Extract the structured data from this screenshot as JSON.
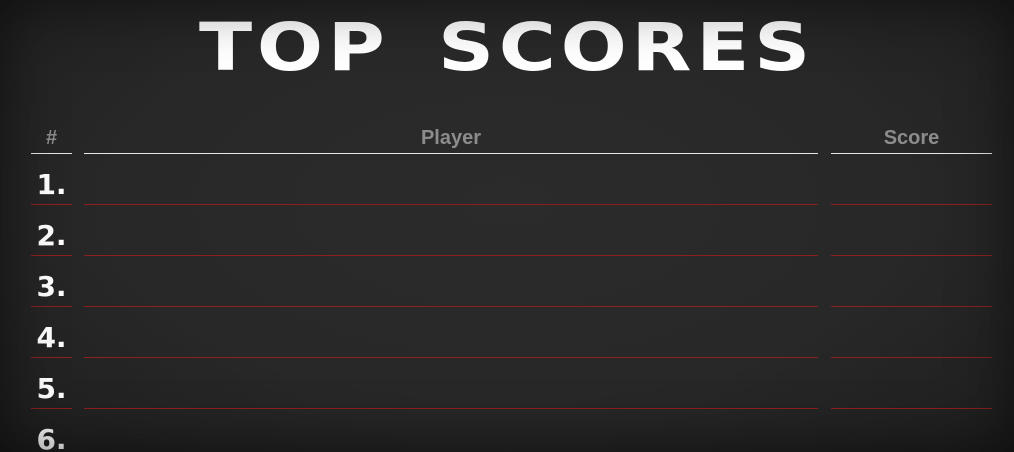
{
  "title": "TOP SCORES",
  "columns": {
    "rank": "#",
    "player": "Player",
    "score": "Score"
  },
  "rows": [
    {
      "rank": "1.",
      "player": "",
      "score": ""
    },
    {
      "rank": "2.",
      "player": "",
      "score": ""
    },
    {
      "rank": "3.",
      "player": "",
      "score": ""
    },
    {
      "rank": "4.",
      "player": "",
      "score": ""
    },
    {
      "rank": "5.",
      "player": "",
      "score": ""
    },
    {
      "rank": "6.",
      "player": "",
      "score": ""
    }
  ],
  "colors": {
    "background": "#262626",
    "title": "#ffffff",
    "header_text": "#8c8c8c",
    "header_rule": "#e6e6e6",
    "row_rule": "#8a2020"
  }
}
